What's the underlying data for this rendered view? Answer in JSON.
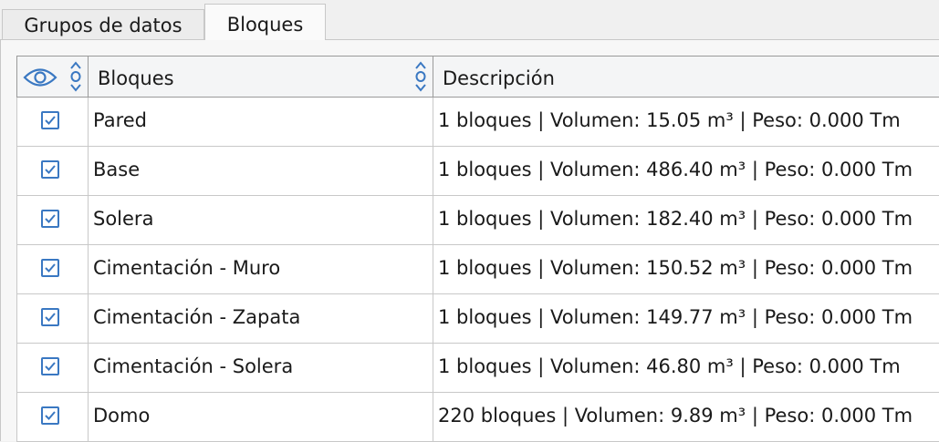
{
  "tabs": [
    {
      "label": "Grupos de datos",
      "active": false
    },
    {
      "label": "Bloques",
      "active": true
    }
  ],
  "table": {
    "columns": {
      "visibility_icon": "eye-icon",
      "name": "Bloques",
      "description": "Descripción"
    },
    "rows": [
      {
        "checked": true,
        "name": "Pared",
        "description": "1 bloques | Volumen: 15.05 m³ | Peso: 0.000 Tm"
      },
      {
        "checked": true,
        "name": "Base",
        "description": "1 bloques | Volumen: 486.40 m³ | Peso: 0.000 Tm"
      },
      {
        "checked": true,
        "name": "Solera",
        "description": "1 bloques | Volumen: 182.40 m³ | Peso: 0.000 Tm"
      },
      {
        "checked": true,
        "name": "Cimentación - Muro",
        "description": "1 bloques | Volumen: 150.52 m³ | Peso: 0.000 Tm"
      },
      {
        "checked": true,
        "name": "Cimentación - Zapata",
        "description": "1 bloques | Volumen: 149.77 m³ | Peso: 0.000 Tm"
      },
      {
        "checked": true,
        "name": "Cimentación - Solera",
        "description": "1 bloques | Volumen: 46.80 m³ | Peso: 0.000 Tm"
      },
      {
        "checked": true,
        "name": "Domo",
        "description": "220 bloques | Volumen: 9.89 m³ | Peso: 0.000 Tm"
      }
    ]
  },
  "colors": {
    "accent": "#3a78c2",
    "grid_line": "#c8c8c8",
    "header_bg": "#f4f5f6"
  }
}
